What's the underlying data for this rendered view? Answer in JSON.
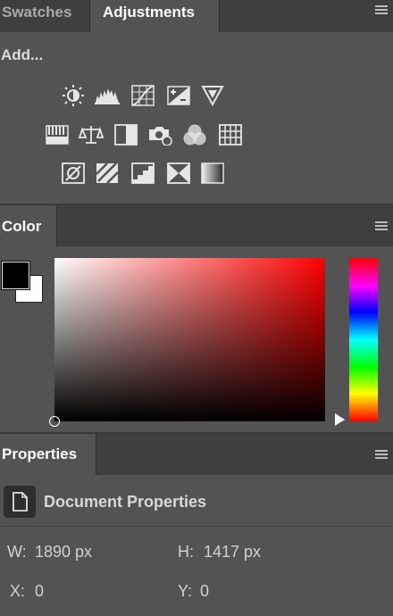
{
  "swatches_panel": {
    "tabs": [
      {
        "label": "Swatches",
        "active": false
      },
      {
        "label": "Adjustments",
        "active": true
      }
    ],
    "add_label": "Add...",
    "icons": [
      [
        "brightness-contrast-icon",
        "levels-icon",
        "curves-icon",
        "exposure-icon",
        "vibrance-icon"
      ],
      [
        "hue-saturation-icon",
        "color-balance-icon",
        "black-white-icon",
        "photo-filter-icon",
        "channel-mixer-icon",
        "color-lookup-icon"
      ],
      [
        "invert-icon",
        "posterize-icon",
        "threshold-icon",
        "selective-color-icon",
        "gradient-map-icon"
      ]
    ]
  },
  "color_panel": {
    "tab": "Color",
    "foreground": "#000000",
    "background": "#ffffff",
    "hue": "#ff0000"
  },
  "properties_panel": {
    "tab": "Properties",
    "title": "Document Properties",
    "width_label": "W:",
    "width_value": "1890 px",
    "height_label": "H:",
    "height_value": "1417 px",
    "x_label": "X:",
    "x_value": "0",
    "y_label": "Y:",
    "y_value": "0"
  }
}
